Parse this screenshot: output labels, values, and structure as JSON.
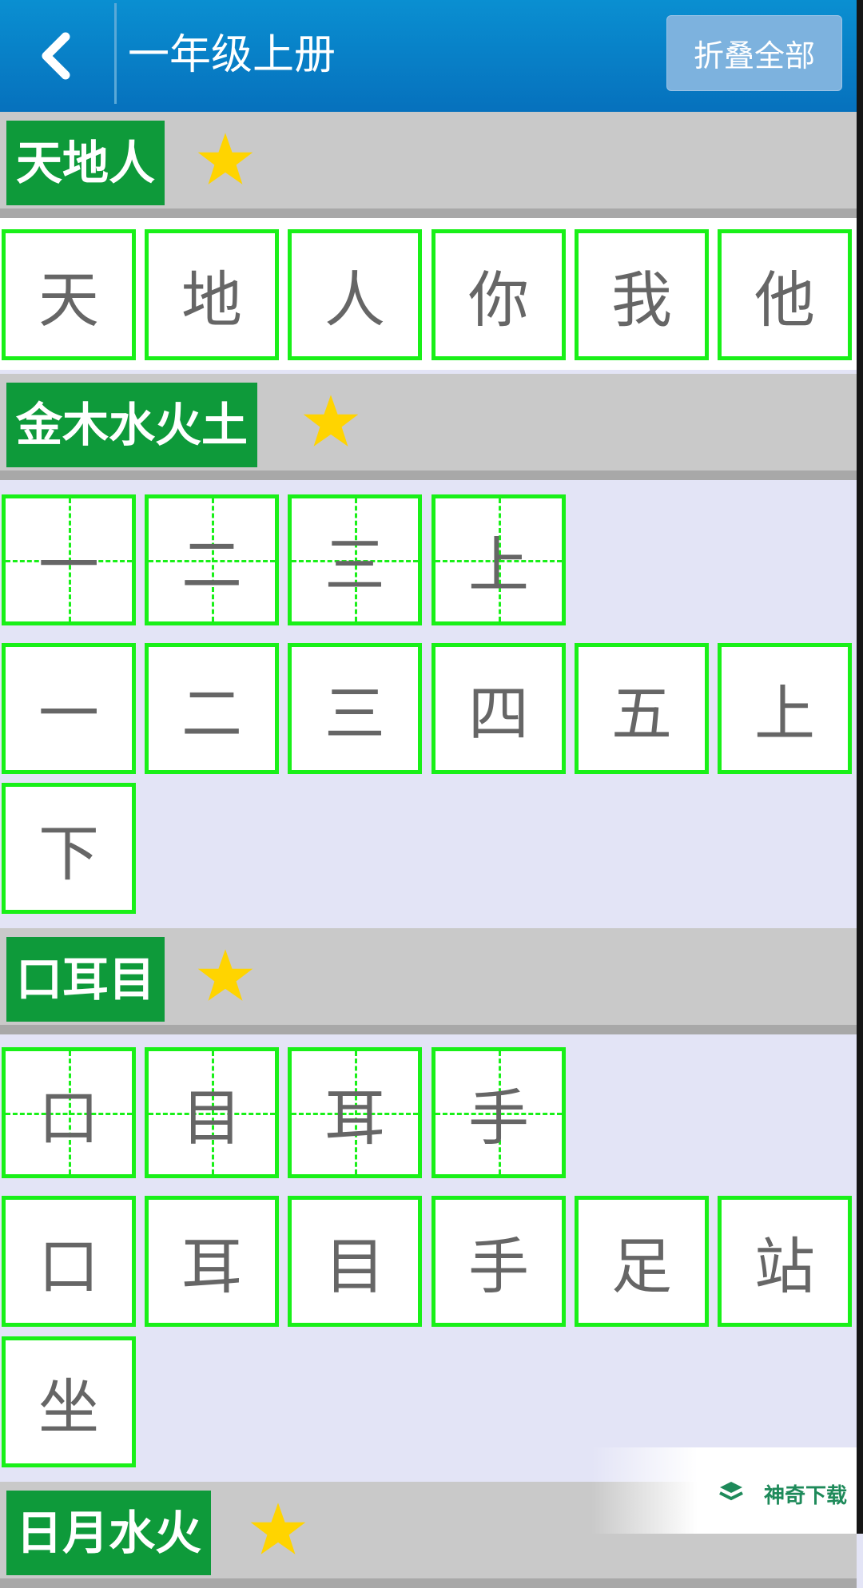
{
  "header": {
    "back_icon": "chevron-left-icon",
    "title": "一年级上册",
    "collapse_all": "折叠全部"
  },
  "colors": {
    "header_blue": "#0671bd",
    "lesson_green": "#0e9a3a",
    "cell_border_green": "#19f018",
    "star_yellow": "#ffd400",
    "list_bg": "#e3e4f6"
  },
  "lessons": [
    {
      "title": "天地人",
      "star_icon": "star-icon",
      "chars": [
        "天",
        "地",
        "人",
        "你",
        "我",
        "他"
      ]
    },
    {
      "title": "金木水火土",
      "star_icon": "star-icon",
      "grid_chars": [
        "一",
        "二",
        "三",
        "上"
      ],
      "chars": [
        "一",
        "二",
        "三",
        "四",
        "五",
        "上",
        "下"
      ]
    },
    {
      "title": "口耳目",
      "star_icon": "star-icon",
      "grid_chars": [
        "口",
        "目",
        "耳",
        "手"
      ],
      "chars": [
        "口",
        "耳",
        "目",
        "手",
        "足",
        "站",
        "坐"
      ]
    },
    {
      "title": "日月水火",
      "star_icon": "star-icon"
    }
  ],
  "watermark": {
    "text": "神奇下载",
    "icon": "shenqi-logo-icon"
  }
}
